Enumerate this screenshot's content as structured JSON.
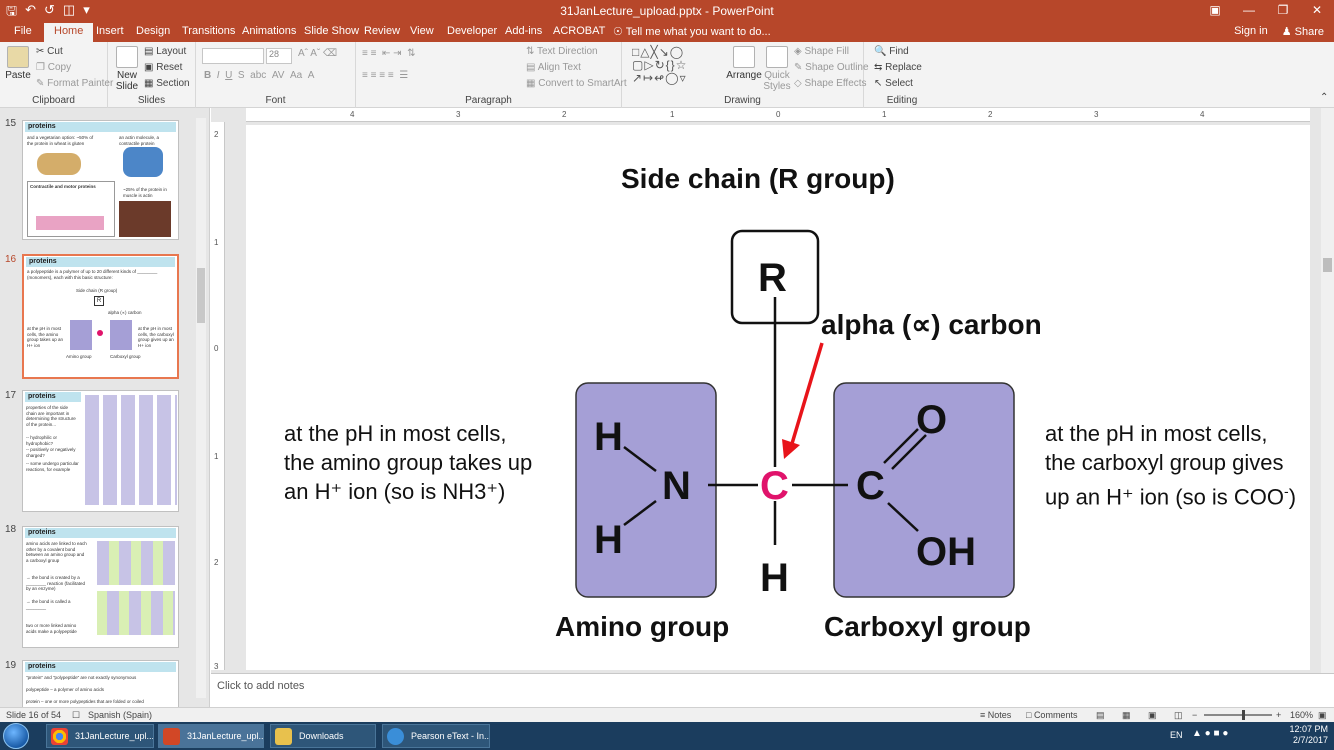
{
  "app": {
    "title": "31JanLecture_upload.pptx - PowerPoint",
    "qat_icons": [
      "save-icon",
      "undo-icon",
      "redo-icon",
      "start-from-beginning-icon",
      "customize-qat-icon"
    ]
  },
  "window_controls": [
    "ribbon-display-icon",
    "minimize-icon",
    "restore-icon",
    "close-icon"
  ],
  "tabs": [
    "File",
    "Home",
    "Insert",
    "Design",
    "Transitions",
    "Animations",
    "Slide Show",
    "Review",
    "View",
    "Developer",
    "Add-ins",
    "ACROBAT"
  ],
  "active_tab": "Home",
  "tell_me": "Tell me what you want to do...",
  "sign_in": "Sign in",
  "share": "Share",
  "ribbon": {
    "clipboard": {
      "label": "Clipboard",
      "paste": "Paste",
      "cut": "Cut",
      "copy": "Copy",
      "format_painter": "Format Painter"
    },
    "slides": {
      "label": "Slides",
      "new_slide": "New Slide",
      "layout": "Layout",
      "reset": "Reset",
      "section": "Section"
    },
    "font": {
      "label": "Font",
      "font_name": "",
      "font_size": "28"
    },
    "paragraph": {
      "label": "Paragraph",
      "text_direction": "Text Direction",
      "align_text": "Align Text",
      "convert_smartart": "Convert to SmartArt"
    },
    "drawing": {
      "label": "Drawing",
      "arrange": "Arrange",
      "quick_styles": "Quick Styles",
      "shape_fill": "Shape Fill",
      "shape_outline": "Shape Outline",
      "shape_effects": "Shape Effects"
    },
    "editing": {
      "label": "Editing",
      "find": "Find",
      "replace": "Replace",
      "select": "Select"
    }
  },
  "thumbnails": [
    {
      "num": "15",
      "title": "proteins",
      "text1": "and a vegetarian option: ~50% of the protein in wheat is gluten",
      "text2": "an actin molecule, a contractile protein",
      "text3": "Contractile and motor proteins",
      "text4": "~25% of the protein in muscle is actin"
    },
    {
      "num": "16",
      "title": "proteins",
      "text1": "a polypeptide is a polymer of up to 20 different kinds of ________ (monomers), each with this basic structure:",
      "side": "Side chain (R group)",
      "alpha": "alpha (∝) carbon",
      "left": "at the pH in most cells, the amino group takes up an H+ ion",
      "right": "at the pH in most cells, the carboxyl group gives up an H+ ion",
      "amino": "Amino group",
      "carboxyl": "Carboxyl group"
    },
    {
      "num": "17",
      "title": "proteins",
      "text1": "properties of the side chain are important in determining the structure of the protein...",
      "text2": "-- hydrophilic or hydrophobic?",
      "text3": "-- positively or negatively charged?",
      "text4": "-- some undergo particular reactions, for example"
    },
    {
      "num": "18",
      "title": "proteins",
      "text1": "amino acids are linked to each other by a covalent bond between an amino group and a carboxyl group",
      "text2": "→ the bond is created by a ________ reaction (facilitated by an enzyme)",
      "text3": "→ the bond is called a ________",
      "text4": "two or more linked amino acids make a polypeptide"
    },
    {
      "num": "19",
      "title": "proteins",
      "text1": "\"protein\" and \"polypeptide\" are not exactly synonymous",
      "text2": "polypeptide – a polymer of amino acids",
      "text3": "protein – one or more polypeptides that are folded or coiled"
    }
  ],
  "slide": {
    "side_chain": "Side chain (R group)",
    "alpha_carbon": "alpha (∝) carbon",
    "left_text": "at the pH in most cells, the amino group takes up an H⁺ ion (so is NH3⁺)",
    "right_text_a": "at the pH in most cells, the carboxyl group gives up an H⁺ ion (so is COO",
    "right_text_sup": "-",
    "right_text_b": ")",
    "amino_group": "Amino group",
    "carboxyl_group": "Carboxyl group",
    "atoms": {
      "r": "R",
      "h": "H",
      "n": "N",
      "c_alpha": "C",
      "c": "C",
      "o": "O",
      "oh": "OH"
    },
    "colors": {
      "group_fill": "#a59fd6",
      "alpha_c": "#e0136b",
      "arrow": "#e8141a"
    }
  },
  "notes_placeholder": "Click to add notes",
  "status": {
    "slide": "Slide 16 of 54",
    "language": "Spanish (Spain)",
    "notes": "Notes",
    "comments": "Comments",
    "zoom": "160%"
  },
  "taskbar": {
    "items": [
      "31JanLecture_upl...",
      "31JanLecture_upl...",
      "Downloads",
      "Pearson eText - In..."
    ],
    "lang": "EN",
    "time": "12:07 PM",
    "date": "2/7/2017"
  }
}
